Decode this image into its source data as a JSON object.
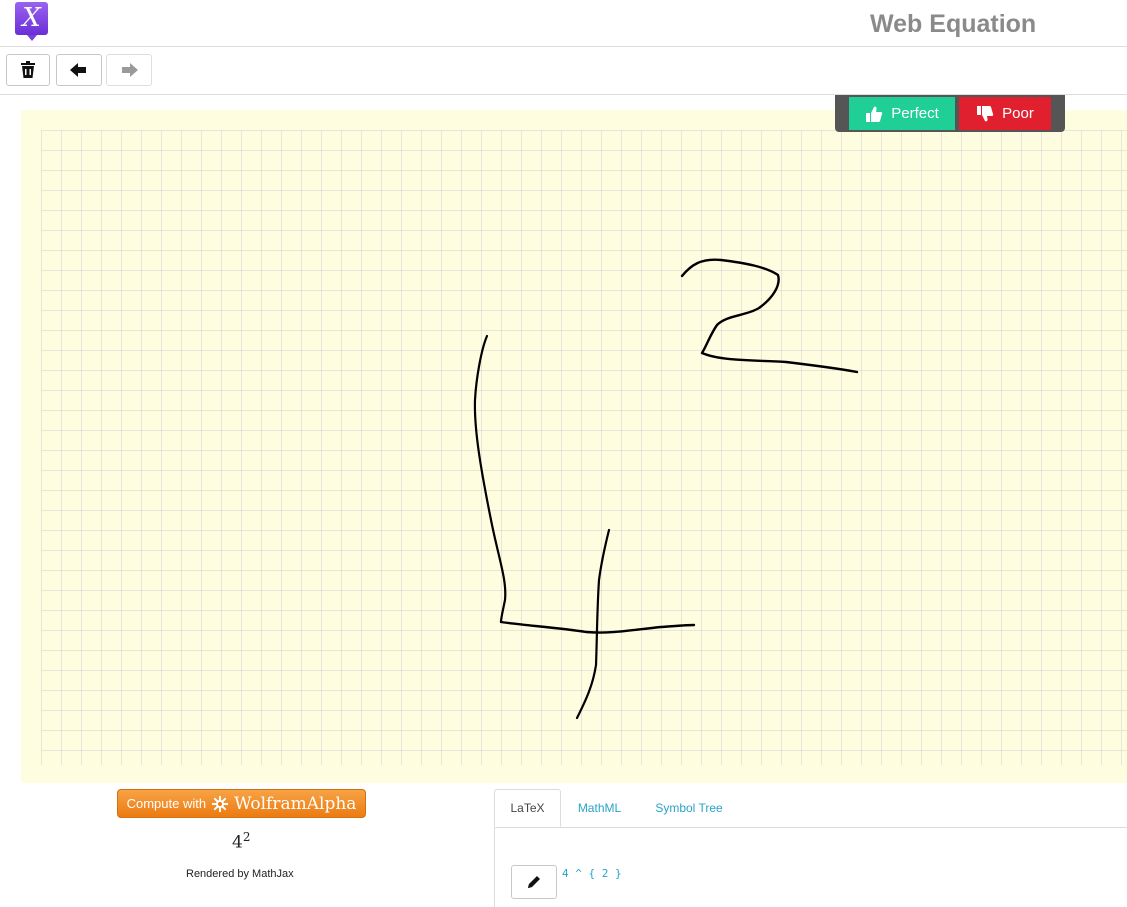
{
  "app": {
    "title": "Web Equation",
    "logo_glyph": "X"
  },
  "toolbar": {
    "clear_icon": "trash-icon",
    "undo_icon": "arrow-left-icon",
    "redo_icon": "arrow-right-icon",
    "redo_enabled": false
  },
  "feedback": {
    "perfect_label": "Perfect",
    "poor_label": "Poor",
    "perfect_color": "#1fcf96",
    "poor_color": "#e0202f"
  },
  "canvas": {
    "background": "#fffde0",
    "grid_color": "#cfcfcf"
  },
  "result": {
    "wolfram_prefix": "Compute with",
    "wolfram_brand": "WolframAlpha",
    "math_base": "4",
    "math_exponent": "2",
    "rendered_by": "Rendered by MathJax"
  },
  "tabs": [
    {
      "label": "LaTeX",
      "active": true
    },
    {
      "label": "MathML",
      "active": false
    },
    {
      "label": "Symbol Tree",
      "active": false
    }
  ],
  "latex": {
    "code": "4 ^ { 2 }"
  }
}
